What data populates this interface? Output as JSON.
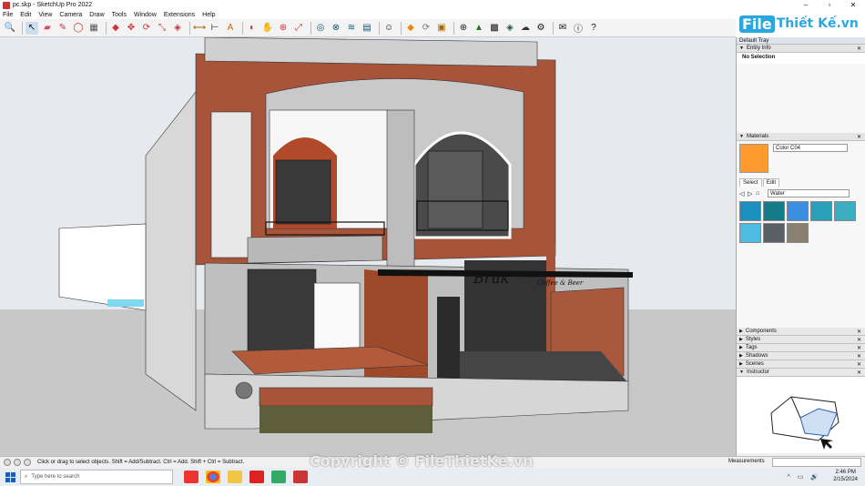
{
  "window": {
    "title": "pc.skp - SketchUp Pro 2022"
  },
  "menu": [
    "File",
    "Edit",
    "View",
    "Camera",
    "Draw",
    "Tools",
    "Window",
    "Extensions",
    "Help"
  ],
  "logo": {
    "part1": "File",
    "part2": "Thiết Kế.vn"
  },
  "tray": {
    "title": "Default Tray",
    "entity_info": {
      "label": "Entity Info",
      "selection": "No Selection"
    },
    "materials": {
      "label": "Materials",
      "name": "Color C04",
      "swatch_color": "#ff9a2e",
      "tabs": [
        "Select",
        "Edit"
      ],
      "library": "Water",
      "swatches": [
        "#1b8fc0",
        "#157a8a",
        "#3c8ee0",
        "#2aa0bb",
        "#3aaec0",
        "#4cbde0",
        "#5a5f66",
        "#8a8070"
      ]
    },
    "collapsed": [
      "Components",
      "Styles",
      "Tags",
      "Shadows",
      "Scenes",
      "Instructor"
    ]
  },
  "status": {
    "hint": "Click or drag to select objects. Shift = Add/Subtract. Ctrl = Add. Shift + Ctrl = Subtract.",
    "measurements_label": "Measurements"
  },
  "taskbar": {
    "search_placeholder": "Type here to search",
    "time": "2:46 PM",
    "date": "2/15/2024"
  },
  "watermark": "Copyright © FileThietKe.vn",
  "sign": {
    "line1": "Bruk",
    "line2": "Coffee & Beer"
  }
}
